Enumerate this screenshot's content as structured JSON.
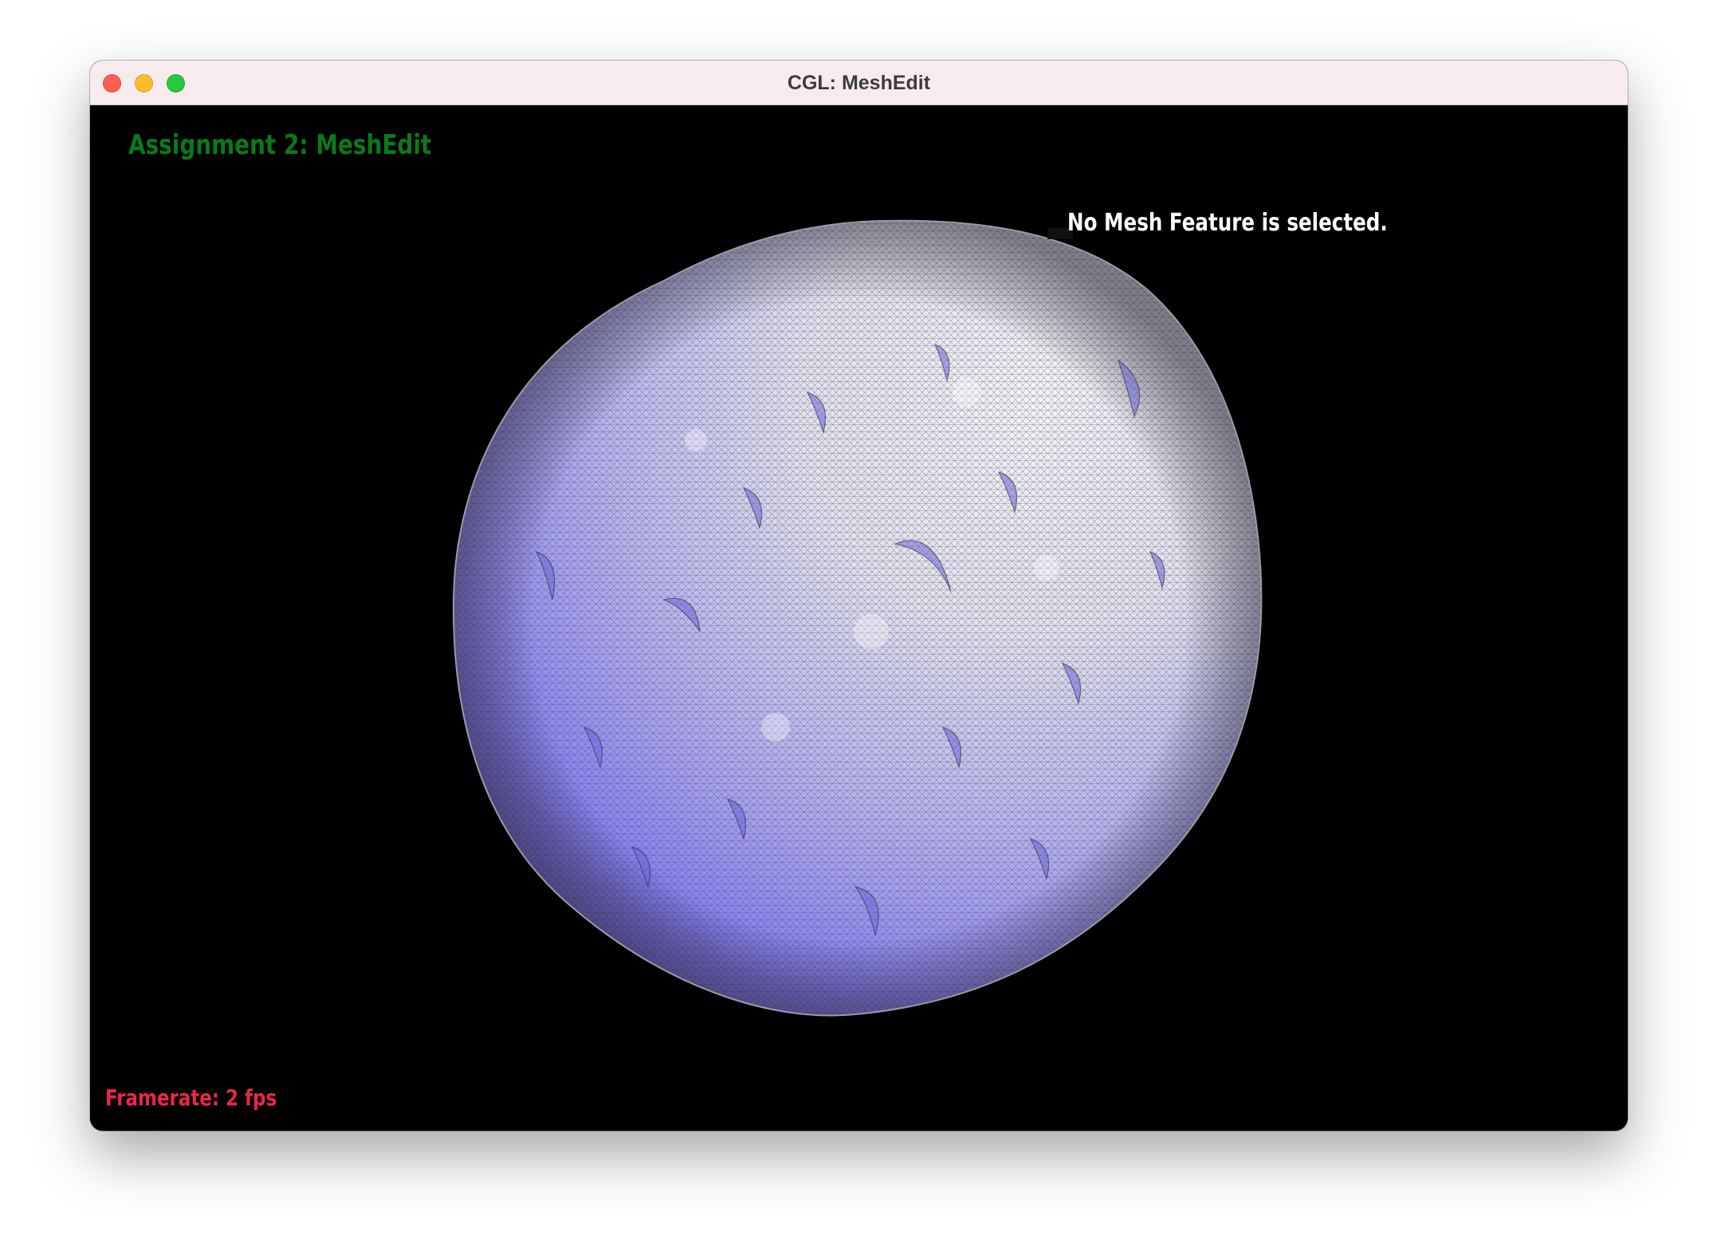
{
  "window": {
    "title": "CGL: MeshEdit"
  },
  "viewport": {
    "heading": "Assignment 2: MeshEdit",
    "selection_status": "No Mesh Feature is selected.",
    "framerate": "Framerate: 2 fps"
  },
  "colors": {
    "heading": "#0a7a18",
    "status": "#ffffff",
    "framerate": "#e8284a",
    "mesh_light": "#f1f1f8",
    "mesh_shade": "#7a73f2",
    "background": "#000000"
  }
}
